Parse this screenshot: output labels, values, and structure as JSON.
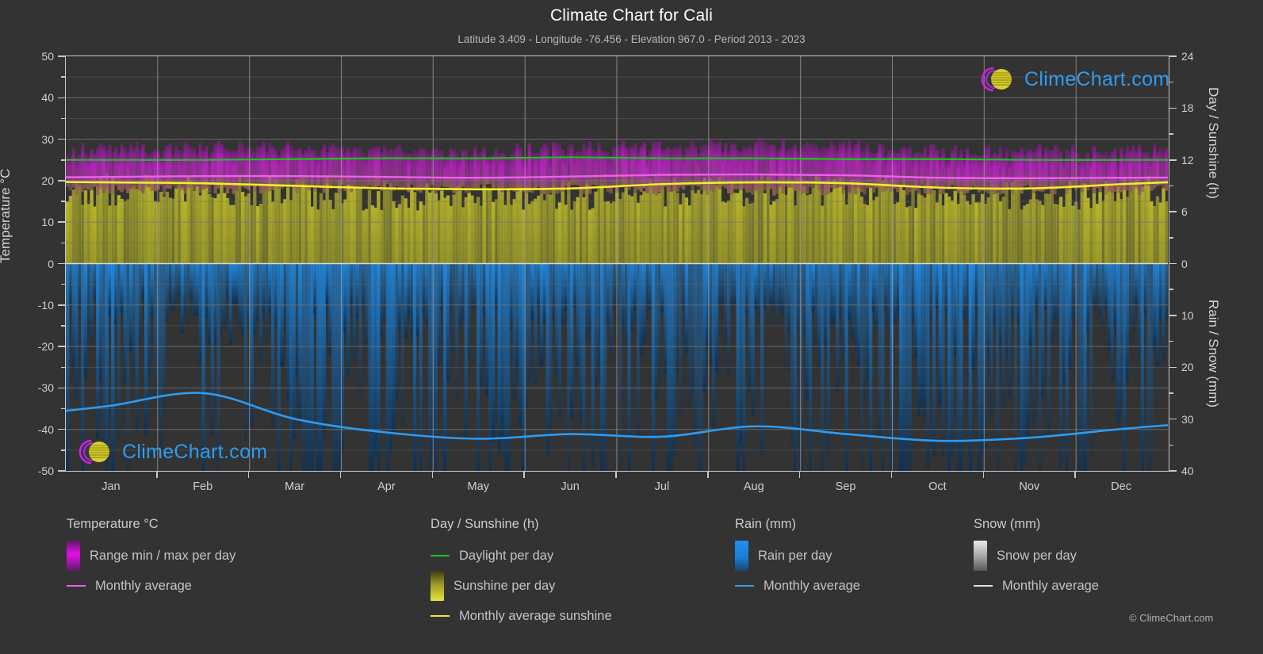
{
  "header": {
    "title": "Climate Chart for Cali",
    "subtitle": "Latitude 3.409 - Longitude -76.456 - Elevation 967.0 - Period 2013 - 2023"
  },
  "watermark": {
    "text": "ClimeChart.com",
    "logo_icon": "climechart-logo-icon",
    "arc_color": "#d421d4",
    "sphere_color": "#d9cf2a"
  },
  "copyright": "© ClimeChart.com",
  "axes": {
    "left": {
      "title": "Temperature °C",
      "ticks": [
        50,
        40,
        30,
        20,
        10,
        0,
        -10,
        -20,
        -30,
        -40,
        -50
      ],
      "min": -50,
      "max": 50
    },
    "right_top": {
      "title": "Day / Sunshine (h)",
      "ticks": [
        24,
        18,
        12,
        6,
        0
      ],
      "min": 0,
      "max": 24
    },
    "right_bottom": {
      "title": "Rain / Snow (mm)",
      "ticks": [
        0,
        10,
        20,
        30,
        40
      ],
      "min": 0,
      "max": 40
    },
    "x": {
      "labels": [
        "Jan",
        "Feb",
        "Mar",
        "Apr",
        "May",
        "Jun",
        "Jul",
        "Aug",
        "Sep",
        "Oct",
        "Nov",
        "Dec"
      ]
    }
  },
  "legend": {
    "columns": [
      {
        "heading": "Temperature °C",
        "items": [
          {
            "label": "Range min / max per day",
            "swatch": "gradient-magenta",
            "color": "#e80ee8"
          },
          {
            "label": "Monthly average",
            "swatch": "line",
            "color": "#f05df0"
          }
        ]
      },
      {
        "heading": "Day / Sunshine (h)",
        "items": [
          {
            "label": "Daylight per day",
            "swatch": "line",
            "color": "#16c916"
          },
          {
            "label": "Sunshine per day",
            "swatch": "gradient-yellow",
            "color": "#e5e53a"
          },
          {
            "label": "Monthly average sunshine",
            "swatch": "line",
            "color": "#e8e832"
          }
        ]
      },
      {
        "heading": "Rain (mm)",
        "items": [
          {
            "label": "Rain per day",
            "swatch": "gradient-blue",
            "color": "#1f90ef"
          },
          {
            "label": "Monthly average",
            "swatch": "line",
            "color": "#35a1f0"
          }
        ]
      },
      {
        "heading": "Snow (mm)",
        "items": [
          {
            "label": "Snow per day",
            "swatch": "gradient-white",
            "color": "#e9e9e9"
          },
          {
            "label": "Monthly average",
            "swatch": "line",
            "color": "#e0e0e0"
          }
        ]
      }
    ]
  },
  "chart_data": {
    "type": "area",
    "title": "Climate Chart for Cali",
    "subtitle": "Latitude 3.409 - Longitude -76.456 - Elevation 967.0 - Period 2013 - 2023",
    "xlabel": "",
    "ylabel": "Temperature °C",
    "categories": [
      "Jan",
      "Feb",
      "Mar",
      "Apr",
      "May",
      "Jun",
      "Jul",
      "Aug",
      "Sep",
      "Oct",
      "Nov",
      "Dec"
    ],
    "ylim": [
      -50,
      50
    ],
    "y2_top_lim": [
      0,
      24
    ],
    "y2_bottom_lim": [
      0,
      40
    ],
    "grid": true,
    "legend_position": "below",
    "series": [
      {
        "name": "Monthly average temperature",
        "unit": "°C",
        "color": "#f05df0",
        "values": [
          20.9,
          21.1,
          21.1,
          20.9,
          20.7,
          21.0,
          21.4,
          21.5,
          21.3,
          20.7,
          20.6,
          20.7
        ]
      },
      {
        "name": "Daily temperature range min",
        "unit": "°C",
        "color": "#a018a0",
        "values": [
          17.6,
          17.8,
          18.0,
          18.1,
          18.0,
          17.8,
          17.6,
          17.6,
          17.7,
          17.8,
          17.8,
          17.7
        ]
      },
      {
        "name": "Daily temperature range max",
        "unit": "°C",
        "color": "#e80ee8",
        "values": [
          26.6,
          27.0,
          26.9,
          26.4,
          26.2,
          26.7,
          27.3,
          27.4,
          27.2,
          26.2,
          26.1,
          26.3
        ]
      },
      {
        "name": "Daylight per day",
        "unit": "h",
        "color": "#16c916",
        "values": [
          12.0,
          12.0,
          12.1,
          12.2,
          12.2,
          12.3,
          12.2,
          12.2,
          12.1,
          12.1,
          12.0,
          12.0
        ]
      },
      {
        "name": "Monthly average sunshine",
        "unit": "h",
        "color": "#e8e832",
        "values": [
          9.4,
          9.3,
          9.0,
          8.7,
          8.6,
          8.7,
          9.2,
          9.4,
          9.3,
          8.8,
          8.7,
          9.2
        ]
      },
      {
        "name": "Monthly average rain",
        "unit": "mm",
        "color": "#35a1f0",
        "values": [
          27.4,
          25.0,
          30.0,
          32.6,
          33.8,
          32.9,
          33.4,
          31.4,
          32.9,
          34.2,
          33.6,
          31.9
        ]
      },
      {
        "name": "Monthly average snow",
        "unit": "mm",
        "color": "#e0e0e0",
        "values": [
          0,
          0,
          0,
          0,
          0,
          0,
          0,
          0,
          0,
          0,
          0,
          0
        ]
      }
    ]
  }
}
